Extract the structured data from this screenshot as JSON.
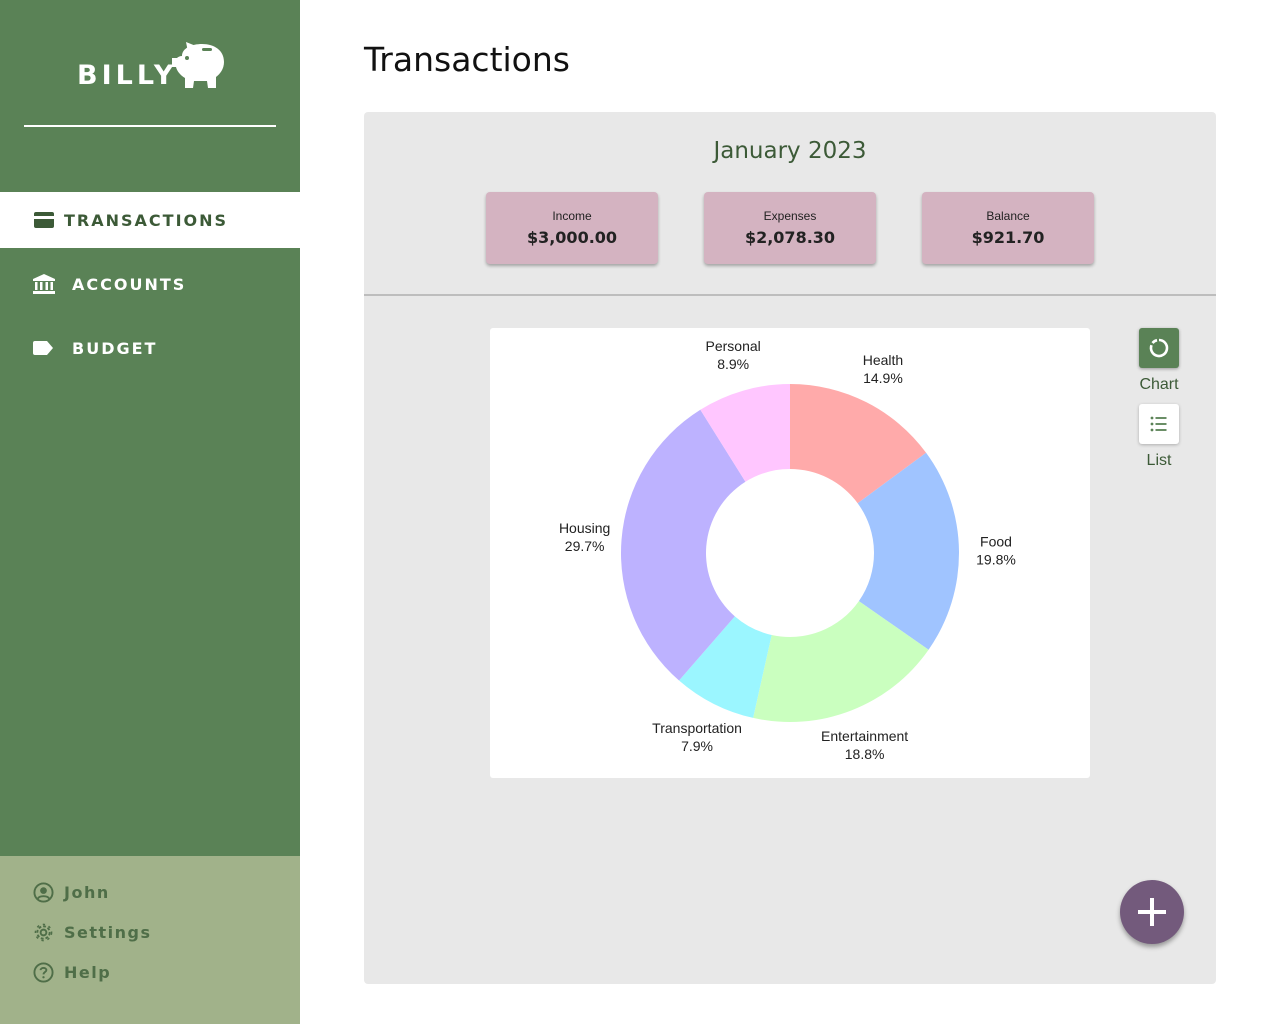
{
  "brand": {
    "name": "BILLY",
    "logo_icon": "piggy-bank-icon"
  },
  "nav": {
    "items": [
      {
        "label": "TRANSACTIONS",
        "icon": "credit-card-icon",
        "active": true
      },
      {
        "label": "ACCOUNTS",
        "icon": "bank-icon",
        "active": false
      },
      {
        "label": "BUDGET",
        "icon": "tag-icon",
        "active": false
      }
    ]
  },
  "user_menu": {
    "items": [
      {
        "label": "John",
        "icon": "user-circle-icon"
      },
      {
        "label": "Settings",
        "icon": "gear-icon"
      },
      {
        "label": "Help",
        "icon": "help-circle-icon"
      }
    ]
  },
  "page": {
    "title": "Transactions"
  },
  "summary": {
    "month": "January 2023",
    "cards": [
      {
        "label": "Income",
        "value": "$3,000.00"
      },
      {
        "label": "Expenses",
        "value": "$2,078.30"
      },
      {
        "label": "Balance",
        "value": "$921.70"
      }
    ]
  },
  "view_toggle": {
    "chart_label": "Chart",
    "list_label": "List",
    "selected": "Chart"
  },
  "fab": {
    "icon": "plus-icon"
  },
  "colors": {
    "sidebar": "#5a8256",
    "sidebar_footer": "#a1b28a",
    "card": "#d4b3c1",
    "fab": "#735a7c",
    "accent_text": "#3c5a37"
  },
  "chart_data": {
    "type": "pie",
    "donut": true,
    "slices": [
      {
        "label": "Health",
        "value": 14.9,
        "display": "14.9%",
        "color": "#ffaaaa"
      },
      {
        "label": "Food",
        "value": 19.8,
        "display": "19.8%",
        "color": "#a0c4ff"
      },
      {
        "label": "Entertainment",
        "value": 18.8,
        "display": "18.8%",
        "color": "#caffbf"
      },
      {
        "label": "Transportation",
        "value": 7.9,
        "display": "7.9%",
        "color": "#9bf6ff"
      },
      {
        "label": "Housing",
        "value": 29.7,
        "display": "29.7%",
        "color": "#bdb2ff"
      },
      {
        "label": "Personal",
        "value": 8.9,
        "display": "8.9%",
        "color": "#ffc6ff"
      }
    ]
  }
}
